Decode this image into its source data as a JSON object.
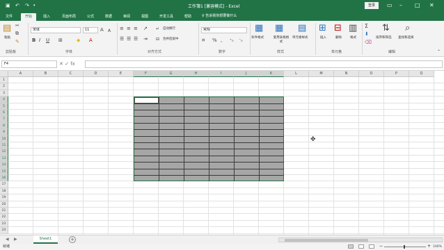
{
  "titlebar": {
    "save_icon": "save-icon",
    "undo_icon": "undo-icon",
    "redo_icon": "redo-icon",
    "title": "工作簿1 [兼容模式] - Excel",
    "login_label": "登录"
  },
  "tabs": [
    {
      "label": "文件"
    },
    {
      "label": "开始",
      "active": true
    },
    {
      "label": "插入"
    },
    {
      "label": "页面布局"
    },
    {
      "label": "公式"
    },
    {
      "label": "数据"
    },
    {
      "label": "审阅"
    },
    {
      "label": "视图"
    },
    {
      "label": "开发工具"
    },
    {
      "label": "帮助"
    }
  ],
  "tell_me": "告诉我你想要做什么",
  "ribbon": {
    "clipboard": {
      "paste_label": "粘贴",
      "group_label": "剪贴板"
    },
    "font": {
      "font_name": "宋体",
      "font_size": "11",
      "bold": "B",
      "italic": "I",
      "underline": "U",
      "group_label": "字体"
    },
    "alignment": {
      "wrap_label": "自动换行",
      "merge_label": "合并后居中",
      "group_label": "对齐方式"
    },
    "number": {
      "format": "常规",
      "percent": "%",
      "comma": ",",
      "group_label": "数字"
    },
    "styles": {
      "conditional": "条件格式",
      "table_fmt": "套用表格格式",
      "cell_style": "单元格样式",
      "group_label": "样式"
    },
    "cells": {
      "insert": "插入",
      "delete": "删除",
      "format": "格式",
      "group_label": "单元格"
    },
    "editing": {
      "sort_filter": "排序和筛选",
      "find_select": "查找和选择",
      "group_label": "编辑"
    }
  },
  "formulabar": {
    "namebox": "F4",
    "fx": "fx"
  },
  "grid": {
    "columns": [
      "A",
      "B",
      "C",
      "D",
      "E",
      "F",
      "G",
      "H",
      "I",
      "J",
      "K",
      "L",
      "M",
      "N",
      "O",
      "P",
      "Q"
    ],
    "rows": [
      "1",
      "2",
      "3",
      "4",
      "5",
      "6",
      "7",
      "8",
      "9",
      "10",
      "11",
      "12",
      "13",
      "14",
      "15",
      "16",
      "17",
      "18",
      "19",
      "20",
      "21",
      "22",
      "23",
      "24"
    ],
    "selected_columns": [
      "F",
      "G",
      "H",
      "I",
      "J",
      "K"
    ],
    "selected_rows": [
      "4",
      "5",
      "6",
      "7",
      "8",
      "9",
      "10",
      "11",
      "12",
      "13",
      "14",
      "15",
      "16"
    ],
    "active_cell": "F4",
    "selection_fill": "#a6a6a6"
  },
  "sheets": [
    {
      "name": "Sheet1",
      "active": true
    }
  ],
  "status": {
    "ready": "就绪",
    "zoom": "100%"
  },
  "colors": {
    "accent": "#217346"
  }
}
